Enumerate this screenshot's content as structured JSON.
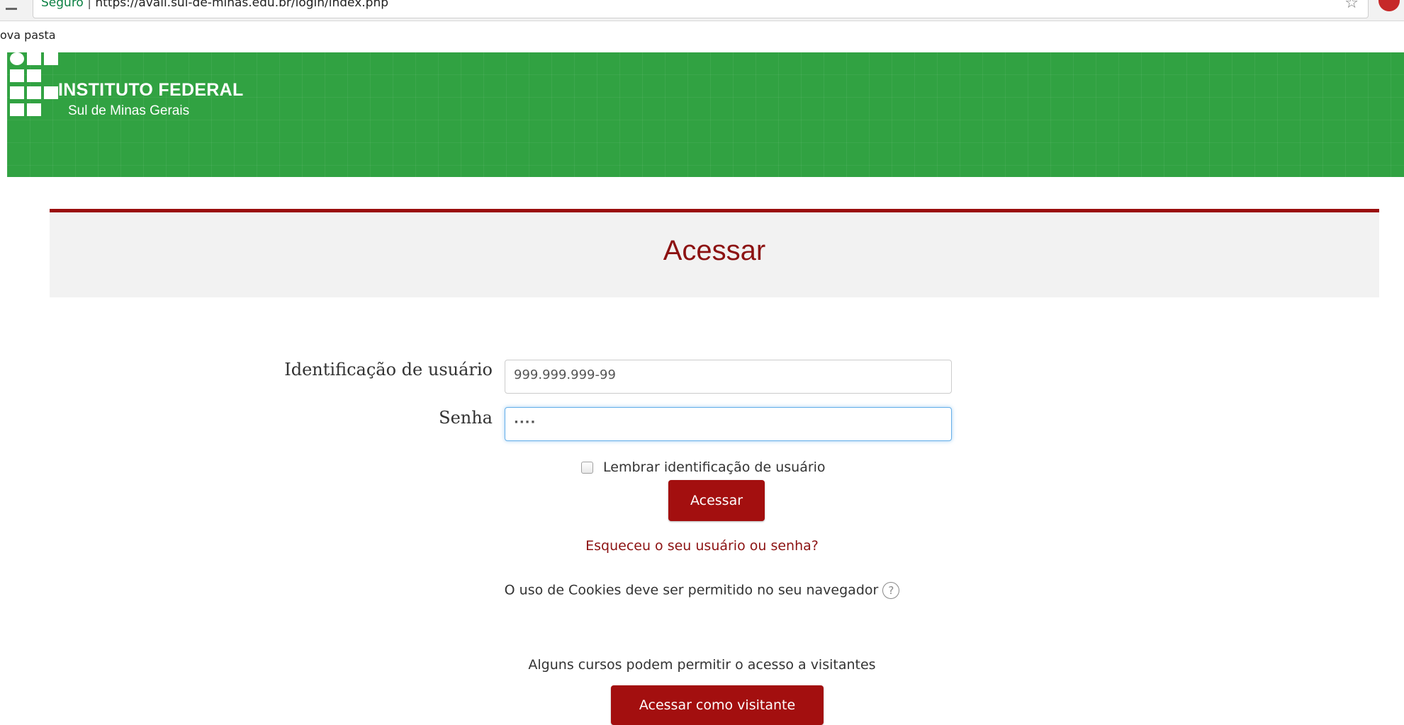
{
  "browser": {
    "secure_label": "Seguro",
    "url": "https://avali.sul-de-minas.edu.br/login/index.php",
    "bookmark": "ova pasta"
  },
  "brand": {
    "title": "INSTITUTO FEDERAL",
    "subtitle": "Sul de Minas Gerais",
    "banner_color": "#31a242"
  },
  "page": {
    "heading": "Acessar",
    "accent_color": "#9a0e0e"
  },
  "form": {
    "username_label": "Identificação de usuário",
    "username_value": "999.999.999-99",
    "password_label": "Senha",
    "password_value": "····",
    "remember_label": "Lembrar identificação de usuário",
    "submit_label": "Acessar",
    "forgot_link": "Esqueceu o seu usuário ou senha?",
    "cookies_notice": "O uso de Cookies deve ser permitido no seu navegador"
  },
  "guest": {
    "notice": "Alguns cursos podem permitir o acesso a visitantes",
    "button_label": "Acessar como visitante"
  }
}
